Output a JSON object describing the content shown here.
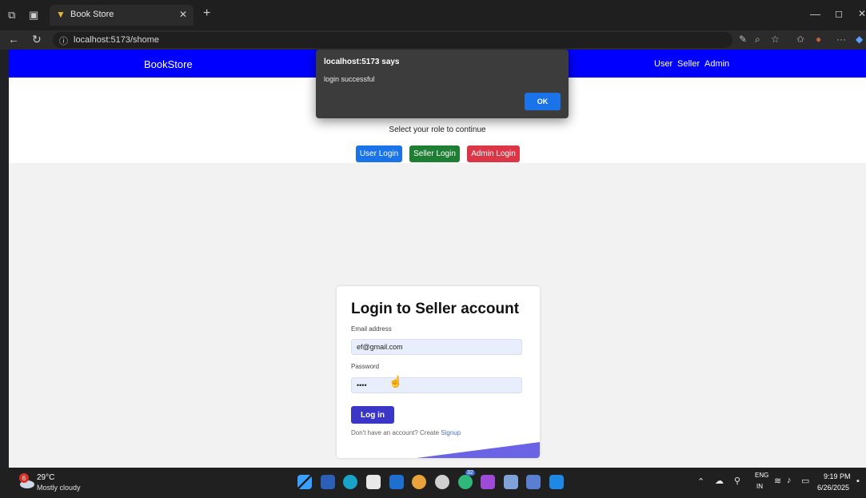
{
  "browser": {
    "tab_title": "Book Store",
    "url": "localhost:5173/shome",
    "icons": [
      "workspaces-icon",
      "tab-actions-icon",
      "back-icon",
      "reload-icon",
      "info-icon",
      "read-aloud-icon",
      "zoom-icon",
      "favorite-icon",
      "favorites-bar-icon",
      "profile-icon",
      "more-icon",
      "copilot-icon"
    ]
  },
  "navbar": {
    "brand": "BookStore",
    "links": [
      "User",
      "Seller",
      "Admin"
    ],
    "bg_color": "#0000ff"
  },
  "hero": {
    "prompt": "Select your role to continue",
    "buttons": {
      "user": "User Login",
      "seller": "Seller Login",
      "admin": "Admin Login"
    },
    "colors": {
      "user": "#1a73e8",
      "seller": "#1e7e34",
      "admin": "#dc3545"
    }
  },
  "alert": {
    "title": "localhost:5173 says",
    "message": "login successful",
    "ok": "OK"
  },
  "login_card": {
    "title": "Login to Seller account",
    "email_label": "Email address",
    "email_value": "ef@gmail.com",
    "password_label": "Password",
    "password_value": "••••",
    "submit": "Log in",
    "signup_text": "Don't have an account? Create",
    "signup_link": "Signup"
  },
  "taskbar": {
    "weather_temp": "29°C",
    "weather_desc": "Mostly cloudy",
    "weather_badge": "6",
    "lang_line1": "ENG",
    "lang_line2": "IN",
    "time": "9:19 PM",
    "date": "6/26/2025",
    "notification_badge": "32"
  }
}
